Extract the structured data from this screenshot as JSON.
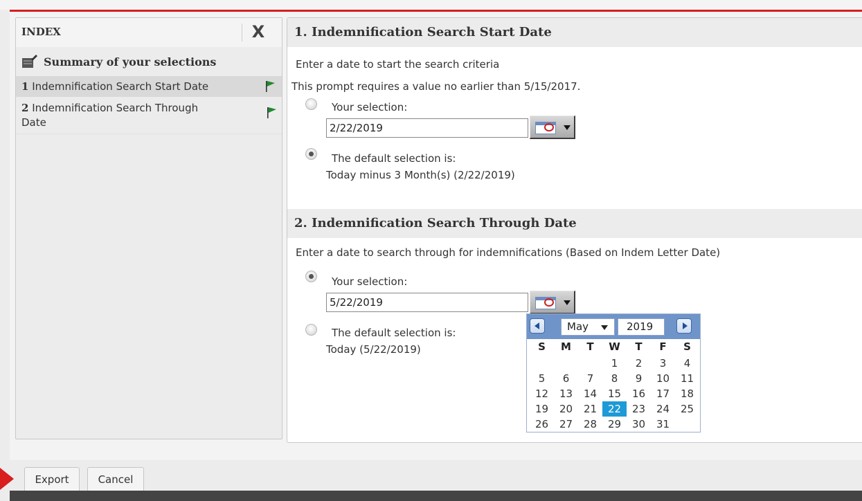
{
  "index": {
    "title": "INDEX",
    "close_label": "X",
    "summary_label": "Summary of your selections",
    "items": [
      {
        "num": "1",
        "label": "Indemnification Search Start Date"
      },
      {
        "num": "2",
        "label_line1": "Indemnification Search Through",
        "label_line2": "Date"
      }
    ]
  },
  "section1": {
    "title": "1. Indemnification Search Start Date",
    "description": "Enter a date to start the search criteria",
    "constraint": "This prompt requires a value no earlier than 5/15/2017.",
    "your_selection_label": "Your selection:",
    "date_value": "2/22/2019",
    "default_label": "The default selection is:",
    "default_value": "Today minus 3 Month(s) (2/22/2019)",
    "selected_option": "default"
  },
  "section2": {
    "title": "2. Indemnification Search Through Date",
    "description": "Enter a date to search through for indemnifications (Based on Indem Letter Date)",
    "your_selection_label": "Your selection:",
    "date_value": "5/22/2019",
    "default_label": "The default selection is:",
    "default_value": "Today (5/22/2019)",
    "selected_option": "your_selection"
  },
  "calendar": {
    "month": "May",
    "year": "2019",
    "weekdays": [
      "S",
      "M",
      "T",
      "W",
      "T",
      "F",
      "S"
    ],
    "weeks": [
      [
        "",
        "",
        "",
        "1",
        "2",
        "3",
        "4"
      ],
      [
        "5",
        "6",
        "7",
        "8",
        "9",
        "10",
        "11"
      ],
      [
        "12",
        "13",
        "14",
        "15",
        "16",
        "17",
        "18"
      ],
      [
        "19",
        "20",
        "21",
        "22",
        "23",
        "24",
        "25"
      ],
      [
        "26",
        "27",
        "28",
        "29",
        "30",
        "31",
        ""
      ]
    ],
    "selected_day": "22"
  },
  "footer": {
    "export_label": "Export",
    "cancel_label": "Cancel"
  },
  "colors": {
    "accent_red": "#d81e1e",
    "flag_green": "#1f8a2e",
    "calendar_header": "#6f94c9",
    "selected_day": "#1e9ad6"
  }
}
